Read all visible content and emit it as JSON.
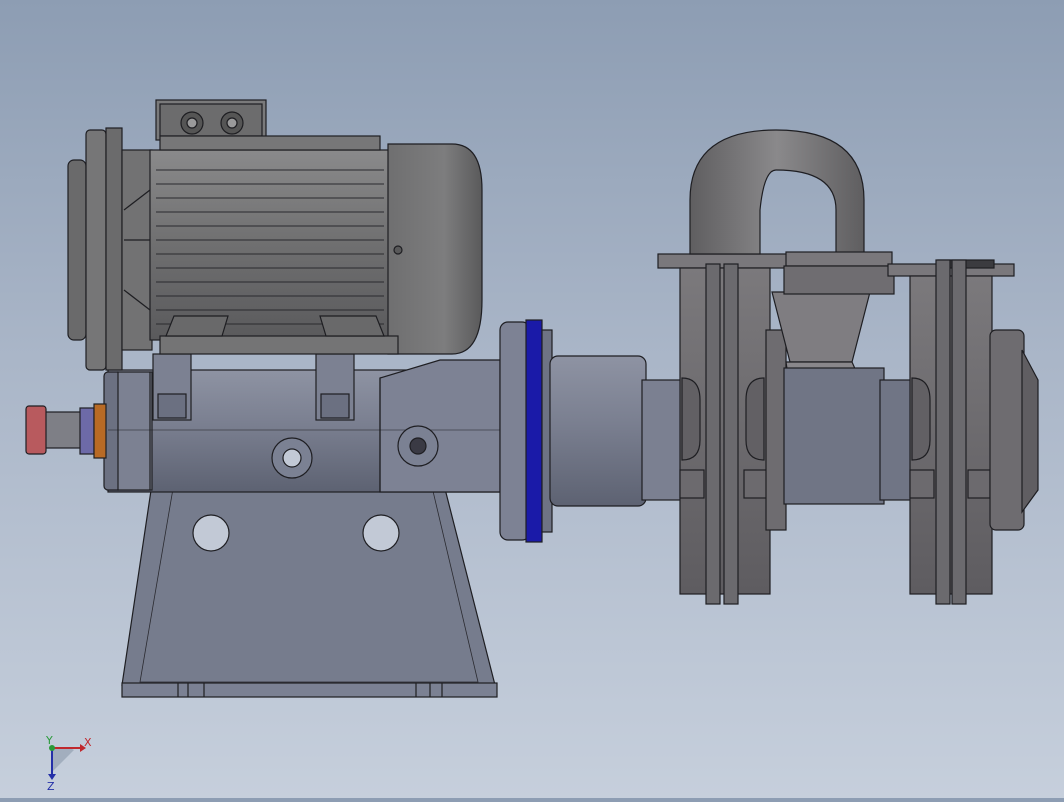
{
  "viewport": {
    "triad": {
      "x_label": "X",
      "y_label": "Y",
      "z_label": "Z"
    }
  },
  "colors": {
    "background_top": "#8d9db3",
    "background_bottom": "#c6cfdc",
    "housing": "#747b8a",
    "motor": "#6f6f70",
    "pump": "#6e6c6f",
    "seal_blue": "#1a1aa8",
    "collar_red": "#b85a5e",
    "collar_orange": "#b86a25",
    "collar_purple": "#6d6aa8",
    "edge": "#1e1e22"
  }
}
